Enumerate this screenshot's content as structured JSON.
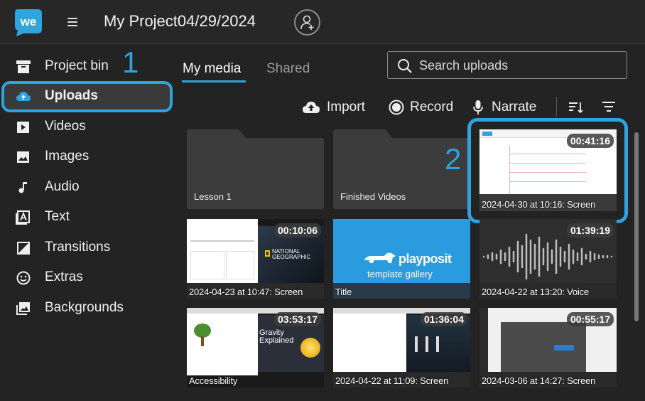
{
  "app": {
    "project_title": "My Project04/29/2024",
    "logo_text": "we"
  },
  "sidebar": {
    "items": [
      {
        "label": "Project bin",
        "icon": "archive-icon"
      },
      {
        "label": "Uploads",
        "icon": "cloud-upload-icon"
      },
      {
        "label": "Videos",
        "icon": "play-square-icon"
      },
      {
        "label": "Images",
        "icon": "image-icon"
      },
      {
        "label": "Audio",
        "icon": "music-note-icon"
      },
      {
        "label": "Text",
        "icon": "text-icon"
      },
      {
        "label": "Transitions",
        "icon": "transition-icon"
      },
      {
        "label": "Extras",
        "icon": "smiley-icon"
      },
      {
        "label": "Backgrounds",
        "icon": "backgrounds-icon"
      }
    ],
    "active": "Uploads"
  },
  "annotations": {
    "step1": "1",
    "step2": "2",
    "highlight_color": "#2ea3e0"
  },
  "tabs": [
    {
      "label": "My media",
      "active": true
    },
    {
      "label": "Shared",
      "active": false
    }
  ],
  "search": {
    "placeholder": "Search uploads",
    "value": ""
  },
  "actions": {
    "import": "Import",
    "record": "Record",
    "narrate": "Narrate"
  },
  "media": [
    {
      "type": "folder",
      "label": "Lesson 1"
    },
    {
      "type": "folder",
      "label": "Finished Videos"
    },
    {
      "type": "video",
      "label": "2024-04-30 at 10:16: Screen",
      "duration": "00:41:16"
    },
    {
      "type": "video",
      "label": "2024-04-23 at 10:47: Screen",
      "duration": "00:10:06",
      "overlay_text": "NATIONAL GEOGRAPHIC"
    },
    {
      "type": "title",
      "label": "Title",
      "brand": "playposit",
      "subtitle": "template gallery"
    },
    {
      "type": "audio",
      "label": "2024-04-22 at 13:20: Voice",
      "duration": "01:39:19"
    },
    {
      "type": "video",
      "label": "Accessibility",
      "duration": "03:53:17",
      "overlay_text": "Gravity Explained"
    },
    {
      "type": "video",
      "label": "2024-04-22 at 11:09: Screen",
      "duration": "01:36:04"
    },
    {
      "type": "video",
      "label": "2024-03-06 at 14:27: Screen",
      "duration": "00:55:17"
    }
  ],
  "colors": {
    "accent": "#2ea3e0",
    "background": "#232323",
    "folder": "#3c3c3c",
    "title_card": "#2b9be0"
  }
}
